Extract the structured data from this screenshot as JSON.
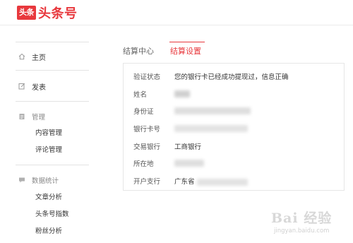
{
  "header": {
    "logo_badge": "头条",
    "logo_text": "头条号"
  },
  "sidebar": {
    "home": "主页",
    "publish": "发表",
    "manage_group": "管理",
    "content_manage": "内容管理",
    "comment_manage": "评论管理",
    "stats_group": "数据统计",
    "article_analysis": "文章分析",
    "toutiao_index": "头条号指数",
    "fans_analysis": "粉丝分析"
  },
  "tabs": {
    "settlement_center": "结算中心",
    "settlement_settings": "结算设置"
  },
  "settings": {
    "rows": [
      {
        "label": "验证状态",
        "value": "您的银行卡已经成功提现过，信息正确"
      },
      {
        "label": "姓名",
        "value": ""
      },
      {
        "label": "身份证",
        "value": ""
      },
      {
        "label": "银行卡号",
        "value": ""
      },
      {
        "label": "交易银行",
        "value": "工商银行"
      },
      {
        "label": "所在地",
        "value": ""
      },
      {
        "label": "开户支行",
        "value": "广东省"
      }
    ]
  },
  "watermark": {
    "main": "Bai 经验",
    "sub": "jingyan.baidu.com"
  },
  "colors": {
    "accent": "#e8383d",
    "border": "#e6e6e6"
  }
}
